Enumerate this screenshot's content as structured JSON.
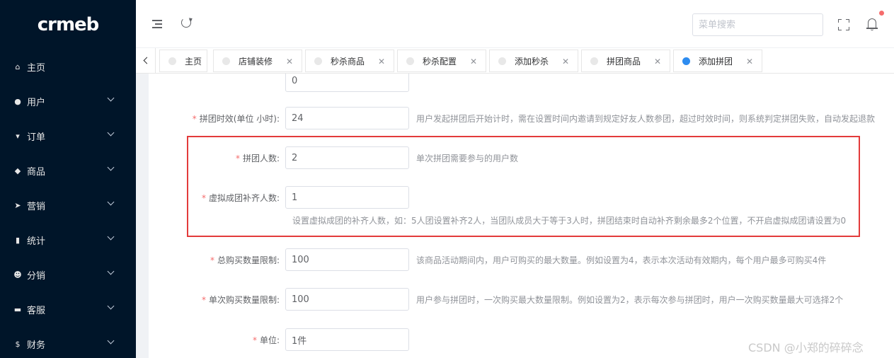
{
  "logo": "crmeb",
  "sidebar": {
    "items": [
      {
        "label": "主页",
        "icon": "home-icon",
        "glyph": "⌂",
        "expandable": false
      },
      {
        "label": "用户",
        "icon": "user-icon",
        "glyph": "●",
        "expandable": true
      },
      {
        "label": "订单",
        "icon": "cart-icon",
        "glyph": "▾",
        "expandable": true
      },
      {
        "label": "商品",
        "icon": "bag-icon",
        "glyph": "◆",
        "expandable": true
      },
      {
        "label": "营销",
        "icon": "send-icon",
        "glyph": "➤",
        "expandable": true
      },
      {
        "label": "统计",
        "icon": "bar-chart-icon",
        "glyph": "▮",
        "expandable": true
      },
      {
        "label": "分销",
        "icon": "team-icon",
        "glyph": "☻",
        "expandable": true
      },
      {
        "label": "客服",
        "icon": "chat-icon",
        "glyph": "▬",
        "expandable": true
      },
      {
        "label": "财务",
        "icon": "dollar-icon",
        "glyph": "$",
        "expandable": true
      }
    ]
  },
  "header": {
    "search_placeholder": "菜单搜索"
  },
  "tabs": [
    {
      "label": "主页",
      "closable": false,
      "active": false
    },
    {
      "label": "店铺装修",
      "closable": true,
      "active": false
    },
    {
      "label": "秒杀商品",
      "closable": true,
      "active": false
    },
    {
      "label": "秒杀配置",
      "closable": true,
      "active": false
    },
    {
      "label": "添加秒杀",
      "closable": true,
      "active": false
    },
    {
      "label": "拼团商品",
      "closable": true,
      "active": false
    },
    {
      "label": "添加拼团",
      "closable": true,
      "active": true
    }
  ],
  "form": {
    "top_value": "0",
    "duration": {
      "label": "拼团时效(单位 小时):",
      "value": "24",
      "hint": "用户发起拼团后开始计时，需在设置时间内邀请到规定好友人数参团，超过时效时间，则系统判定拼团失败，自动发起退款"
    },
    "people": {
      "label": "拼团人数:",
      "value": "2",
      "hint": "单次拼团需要参与的用户数"
    },
    "virtual": {
      "label": "虚拟成团补齐人数:",
      "value": "1",
      "hint": "设置虚拟成团的补齐人数，如：5人团设置补齐2人，当团队成员大于等于3人时，拼团结束时自动补齐剩余最多2个位置，不开启虚拟成团请设置为0"
    },
    "total_limit": {
      "label": "总购买数量限制:",
      "value": "100",
      "hint": "该商品活动期间内，用户可购买的最大数量。例如设置为4，表示本次活动有效期内，每个用户最多可购买4件"
    },
    "single_limit": {
      "label": "单次购买数量限制:",
      "value": "100",
      "hint": "用户参与拼团时，一次购买最大数量限制。例如设置为2，表示每次参与拼团时，用户一次购买数量最大可选择2个"
    },
    "unit": {
      "label": "单位:",
      "value": "1件"
    },
    "required_mark": "*"
  },
  "watermark": "CSDN @小郑的碎碎念",
  "colors": {
    "sidebar_bg": "#001529",
    "active_tab_dot": "#2d8cf0",
    "required": "#f56c6c",
    "highlight_box": "#e33b3b",
    "notification_dot": "#f56c6c"
  }
}
